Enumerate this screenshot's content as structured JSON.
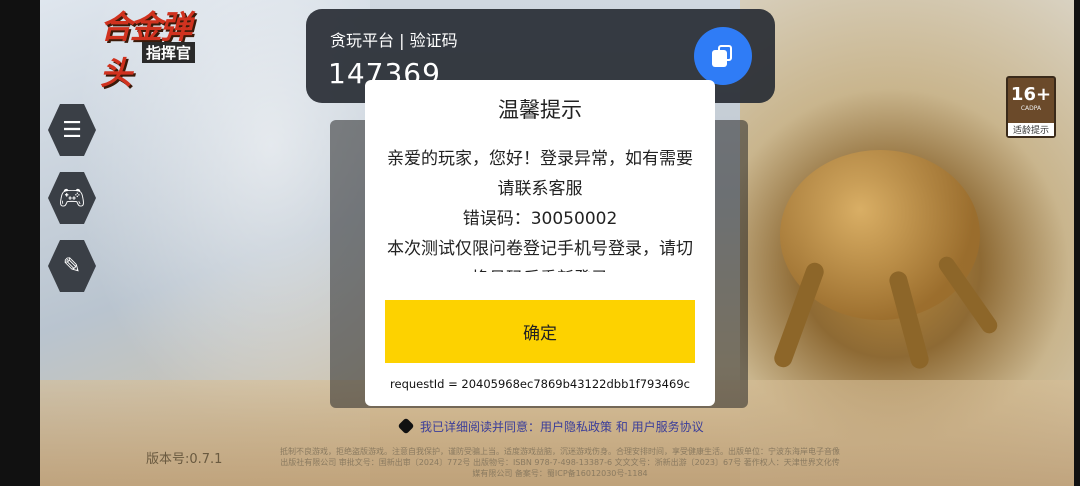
{
  "logo": {
    "line1": "合金弹头",
    "line2": "指挥官"
  },
  "sidebar": {
    "icons": [
      "announcement-icon",
      "gamepad-icon",
      "edit-note-icon"
    ]
  },
  "age_rating": {
    "age": "16+",
    "org": "CADPA",
    "tip": "适龄提示"
  },
  "verification": {
    "title": "贪玩平台 | 验证码",
    "code": "147369",
    "copy_icon": "copy-icon",
    "accent": "#2f7cf6"
  },
  "dialog": {
    "title": "温馨提示",
    "message_line1": "亲爱的玩家，您好！登录异常，如有需要请联系客服",
    "message_line2": "错误码：30050002",
    "message_line3": "本次测试仅限问卷登记手机号登录，请切换号码后重新登录",
    "ok_label": "确定",
    "ok_color": "#fdd200",
    "request_id": "requestId = 20405968ec7869b43122dbb1f793469c"
  },
  "agreement": {
    "text": "我已详细阅读并同意：用户隐私政策 和 用户服务协议"
  },
  "footer": {
    "version": "版本号:0.7.1",
    "legal": "抵制不良游戏，拒绝盗版游戏。注意自我保护，谨防受骗上当。适度游戏益脑，沉迷游戏伤身。合理安排时间，享受健康生活。出版单位：宁波东海岸电子音像出版社有限公司 审批文号：国新出审〔2024〕772号 出版物号：ISBN 978-7-498-13387-6 文文文号：浙新出游〔2023〕67号 著作权人：天津世界文化传媒有限公司 备案号：蜀ICP备16012030号-1184"
  }
}
